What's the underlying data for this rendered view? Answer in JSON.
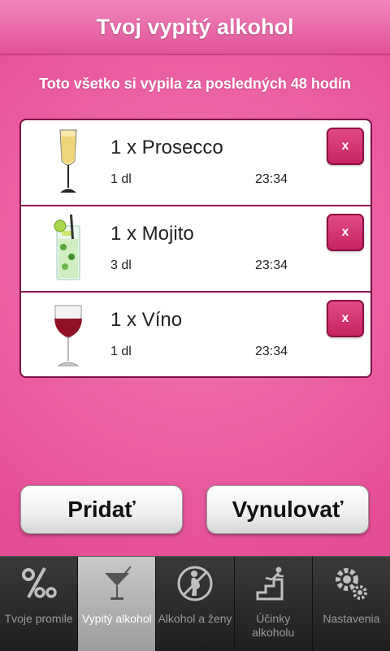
{
  "header": {
    "title": "Tvoj vypitý alkohol"
  },
  "subtitle": "Toto všetko si vypila za posledných 48 hodín",
  "drinks": [
    {
      "title": "1 x Prosecco",
      "volume": "1 dl",
      "time": "23:34",
      "icon": "prosecco-glass-icon",
      "remove_label": "x"
    },
    {
      "title": "1 x Mojito",
      "volume": "3 dl",
      "time": "23:34",
      "icon": "mojito-glass-icon",
      "remove_label": "x"
    },
    {
      "title": "1 x Víno",
      "volume": "1 dl",
      "time": "23:34",
      "icon": "wine-glass-icon",
      "remove_label": "x"
    }
  ],
  "actions": {
    "add_label": "Pridať",
    "reset_label": "Vynulovať"
  },
  "tabs": [
    {
      "label": "Tvoje promile",
      "icon": "permille-icon",
      "active": false
    },
    {
      "label": "Vypitý alkohol",
      "icon": "cocktail-icon",
      "active": true
    },
    {
      "label": "Alkohol a ženy",
      "icon": "pregnant-woman-icon",
      "active": false
    },
    {
      "label": "Účinky alkoholu",
      "icon": "falling-stairs-icon",
      "active": false
    },
    {
      "label": "Nastavenia",
      "icon": "gears-icon",
      "active": false
    }
  ],
  "colors": {
    "accent": "#e64f98",
    "header": "#e0539a",
    "border": "#7b0f45",
    "button": "#c62461"
  }
}
